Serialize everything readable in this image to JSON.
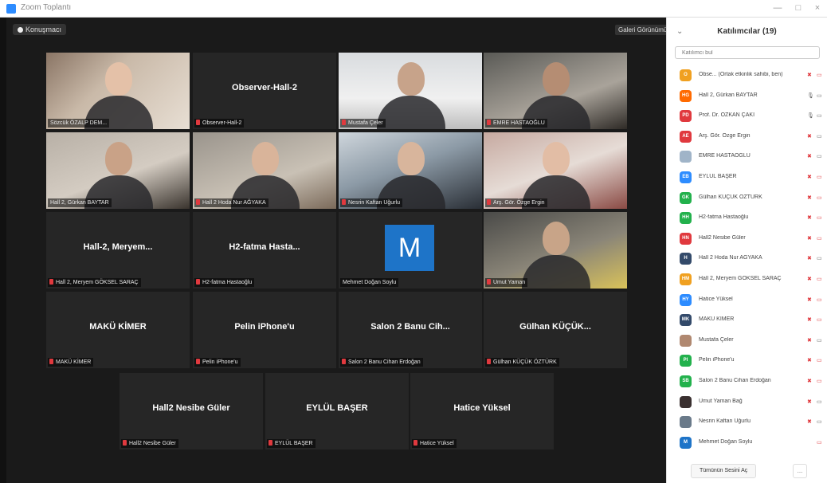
{
  "window": {
    "title": "Zoom Toplantı",
    "controls": [
      "—",
      "□",
      "×"
    ]
  },
  "meeting": {
    "view_button": "Konuşmacı",
    "view_mode": "Galeri Görünümü",
    "tiles": [
      {
        "name": "",
        "label": "Sözcük ÖZALP DEM...",
        "muted": false,
        "video": true
      },
      {
        "name": "Observer-Hall-2",
        "label": "Observer-Hall-2",
        "muted": true,
        "video": false
      },
      {
        "name": "",
        "label": "Mustafa Çeler",
        "muted": true,
        "video": true
      },
      {
        "name": "",
        "label": "EMRE HASTAOĞLU",
        "muted": true,
        "video": true
      },
      {
        "name": "",
        "label": "Hall 2, Gürkan BAYTAR",
        "muted": false,
        "video": true
      },
      {
        "name": "",
        "label": "Hall 2 Hoda Nur AĞYAKA",
        "muted": true,
        "video": true
      },
      {
        "name": "",
        "label": "Nesrin Kaftan Uğurlu",
        "muted": true,
        "video": true
      },
      {
        "name": "",
        "label": "Arş. Gör. Özge Ergin",
        "muted": true,
        "video": true
      },
      {
        "name": "Hall-2, Meryem...",
        "label": "Hall 2, Meryem GÖKSEL SARAÇ",
        "muted": true,
        "video": false
      },
      {
        "name": "H2-fatma Hasta...",
        "label": "H2-fatma Hastaoğlu",
        "muted": true,
        "video": false
      },
      {
        "name": "",
        "label": "Mehmet Doğan Soylu",
        "muted": false,
        "video": false,
        "avatar": "M"
      },
      {
        "name": "",
        "label": "Umut Yaman",
        "muted": true,
        "video": true
      },
      {
        "name": "MAKÜ KİMER",
        "label": "MAKÜ KİMER",
        "muted": true,
        "video": false
      },
      {
        "name": "Pelin iPhone'u",
        "label": "Pelin iPhone'u",
        "muted": true,
        "video": false
      },
      {
        "name": "Salon 2 Banu Cih...",
        "label": "Salon 2 Banu Cihan Erdoğan",
        "muted": true,
        "video": false
      },
      {
        "name": "Gülhan KÜÇÜK...",
        "label": "Gülhan KÜÇÜK ÖZTÜRK",
        "muted": true,
        "video": false
      },
      {
        "name": "Hall2 Nesibe Güler",
        "label": "Hall2 Nesibe Güler",
        "muted": true,
        "video": false
      },
      {
        "name": "EYLÜL BAŞER",
        "label": "EYLÜL BAŞER",
        "muted": true,
        "video": false
      },
      {
        "name": "Hatice Yüksel",
        "label": "Hatice Yüksel",
        "muted": true,
        "video": false
      }
    ]
  },
  "panel": {
    "title": "Katılımcılar (19)",
    "search_placeholder": "Katılımcı bul",
    "participants": [
      {
        "initials": "O",
        "color": "#f0a020",
        "name": "Obse... (Ortak etkinlik sahibi, ben)",
        "mic": "muted",
        "cam": "off"
      },
      {
        "initials": "HG",
        "color": "#ff6a00",
        "name": "Hall 2, Gürkan BAYTAR",
        "mic": "on",
        "cam": "on"
      },
      {
        "initials": "PD",
        "color": "#e0393e",
        "name": "Prof. Dr. ÖZKAN ÇAKI",
        "mic": "on",
        "cam": "on"
      },
      {
        "initials": "AE",
        "color": "#e0393e",
        "name": "Arş. Gör. Özge Ergin",
        "mic": "muted",
        "cam": "on"
      },
      {
        "initials": "",
        "color": "#a0b4c8",
        "name": "EMRE HASTAOĞLU",
        "mic": "muted",
        "cam": "on"
      },
      {
        "initials": "EB",
        "color": "#2d8cff",
        "name": "EYLÜL BAŞER",
        "mic": "muted",
        "cam": "off"
      },
      {
        "initials": "GK",
        "color": "#22b14c",
        "name": "Gülhan KÜÇÜK ÖZTÜRK",
        "mic": "muted",
        "cam": "off"
      },
      {
        "initials": "HH",
        "color": "#22b14c",
        "name": "H2-fatma Hastaoğlu",
        "mic": "muted",
        "cam": "off"
      },
      {
        "initials": "HN",
        "color": "#e0393e",
        "name": "Hall2 Nesibe Güler",
        "mic": "muted",
        "cam": "off"
      },
      {
        "initials": "H",
        "color": "#334a6a",
        "name": "Hall 2 Hoda Nur AĞYAKA",
        "mic": "muted",
        "cam": "on"
      },
      {
        "initials": "HM",
        "color": "#f0a020",
        "name": "Hall 2, Meryem GÖKSEL SARAÇ",
        "mic": "muted",
        "cam": "off"
      },
      {
        "initials": "HY",
        "color": "#2d8cff",
        "name": "Hatice Yüksel",
        "mic": "muted",
        "cam": "off"
      },
      {
        "initials": "MK",
        "color": "#334a6a",
        "name": "MAKÜ KİMER",
        "mic": "muted",
        "cam": "off"
      },
      {
        "initials": "",
        "color": "#b08870",
        "name": "Mustafa Çeler",
        "mic": "muted",
        "cam": "on"
      },
      {
        "initials": "PI",
        "color": "#22b14c",
        "name": "Pelin iPhone'u",
        "mic": "muted",
        "cam": "off"
      },
      {
        "initials": "SB",
        "color": "#22b14c",
        "name": "Salon 2 Banu Cihan Erdoğan",
        "mic": "muted",
        "cam": "off"
      },
      {
        "initials": "",
        "color": "#3a3030",
        "name": "Umut Yaman Bağ",
        "mic": "muted",
        "cam": "on"
      },
      {
        "initials": "",
        "color": "#6a7a8a",
        "name": "Nesrin Kaftan Uğurlu",
        "mic": "muted",
        "cam": "on"
      },
      {
        "initials": "M",
        "color": "#1e74c8",
        "name": "Mehmet Doğan Soylu",
        "mic": "none",
        "cam": "off"
      }
    ],
    "footer_button": "Tümünün Sesini Aç",
    "more_button": "..."
  }
}
